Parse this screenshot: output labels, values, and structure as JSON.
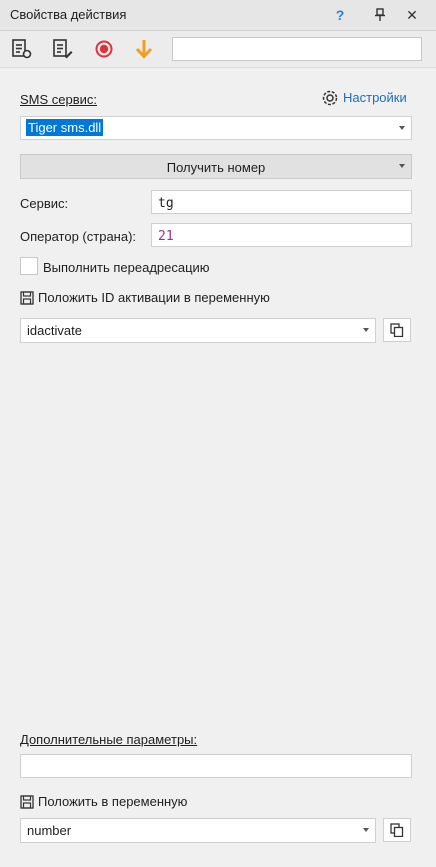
{
  "window": {
    "title": "Свойства действия"
  },
  "title_buttons": {
    "help": "?",
    "pin": "⊥",
    "close": "✕"
  },
  "toolbar": {
    "search_value": ""
  },
  "sms": {
    "section_label": "SMS сервис:",
    "settings_link": "Настройки",
    "service_value": "Tiger sms.dll",
    "get_number_label": "Получить номер"
  },
  "fields": {
    "service_label": "Сервис:",
    "service_value": "tg",
    "operator_label": "Оператор (страна):",
    "operator_value": "21"
  },
  "redirect": {
    "label": "Выполнить переадресацию",
    "checked": false
  },
  "activation": {
    "label": "Положить ID активации в переменную",
    "variable": "idactivate"
  },
  "extra": {
    "label": "Дополнительные параметры:",
    "value": ""
  },
  "output": {
    "label": "Положить в переменную",
    "variable": "number"
  },
  "colors": {
    "accent_blue": "#0078d7",
    "record_red": "#e0323c",
    "arrow_orange": "#f0a020",
    "operator_text": "#9b2d9b"
  }
}
